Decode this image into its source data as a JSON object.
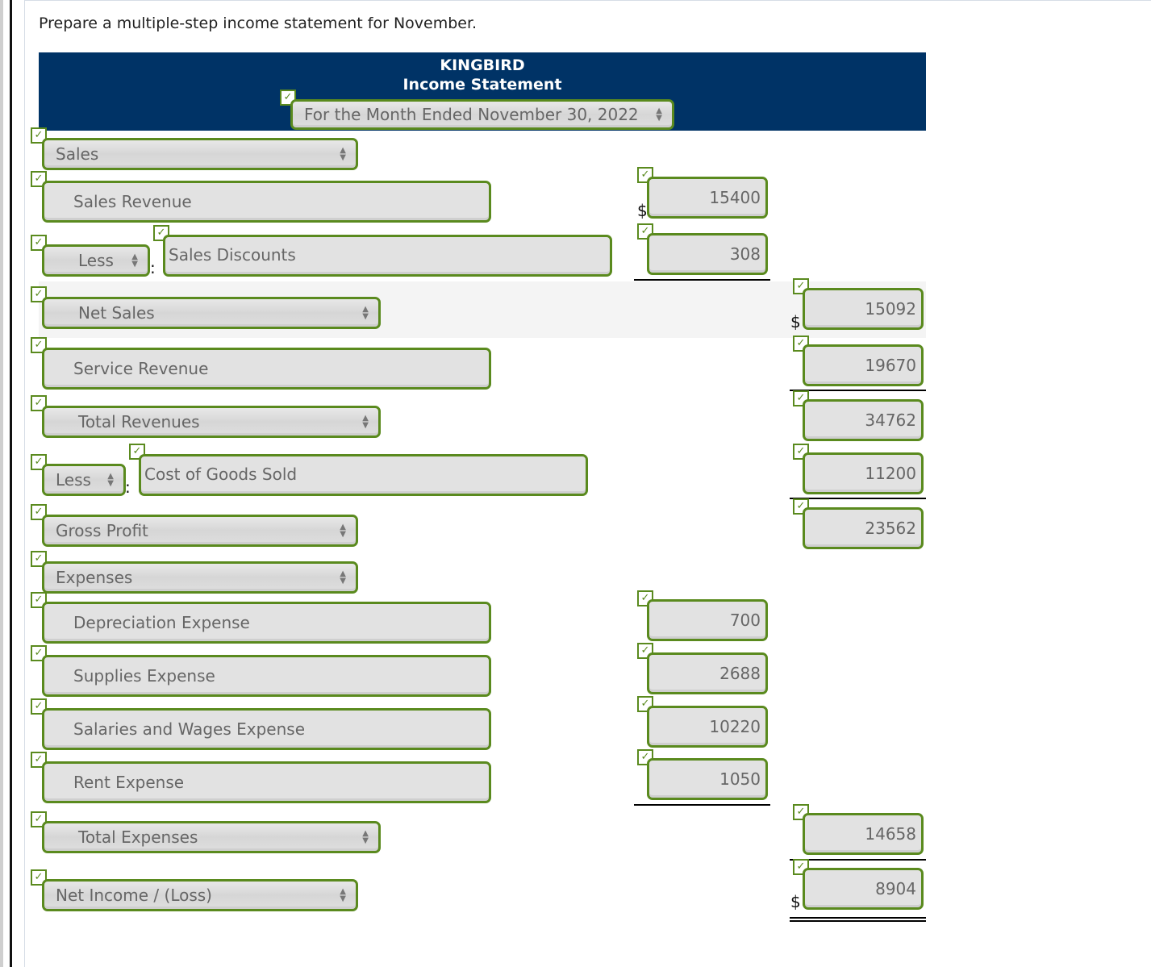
{
  "prompt": "Prepare a multiple-step income statement for November.",
  "header": {
    "company": "KINGBIRD",
    "title": "Income Statement",
    "period": "For the Month Ended November 30, 2022"
  },
  "symbols": {
    "dollar": "$",
    "colon": ":",
    "check": "✓",
    "arrow_up": "▲",
    "arrow_down": "▼"
  },
  "rows": {
    "sales_heading": {
      "label": "Sales"
    },
    "sales_revenue": {
      "label": "Sales Revenue",
      "amount": "15400"
    },
    "sales_discounts": {
      "operator": "Less",
      "label": "Sales Discounts",
      "amount": "308"
    },
    "net_sales": {
      "label": "Net Sales",
      "amount": "15092"
    },
    "service_revenue": {
      "label": "Service Revenue",
      "amount": "19670"
    },
    "total_revenues": {
      "label": "Total Revenues",
      "amount": "34762"
    },
    "cogs": {
      "operator": "Less",
      "label": "Cost of Goods Sold",
      "amount": "11200"
    },
    "gross_profit": {
      "label": "Gross Profit",
      "amount": "23562"
    },
    "expenses_heading": {
      "label": "Expenses"
    },
    "depreciation": {
      "label": "Depreciation Expense",
      "amount": "700"
    },
    "supplies": {
      "label": "Supplies Expense",
      "amount": "2688"
    },
    "salaries": {
      "label": "Salaries and Wages Expense",
      "amount": "10220"
    },
    "rent": {
      "label": "Rent Expense",
      "amount": "1050"
    },
    "total_expenses": {
      "label": "Total Expenses",
      "amount": "14658"
    },
    "net_income": {
      "label": "Net Income / (Loss)",
      "amount": "8904"
    }
  },
  "colors": {
    "header_bg": "#003366",
    "correct_border": "#5a8a1e",
    "field_bg": "#e2e2e2"
  }
}
